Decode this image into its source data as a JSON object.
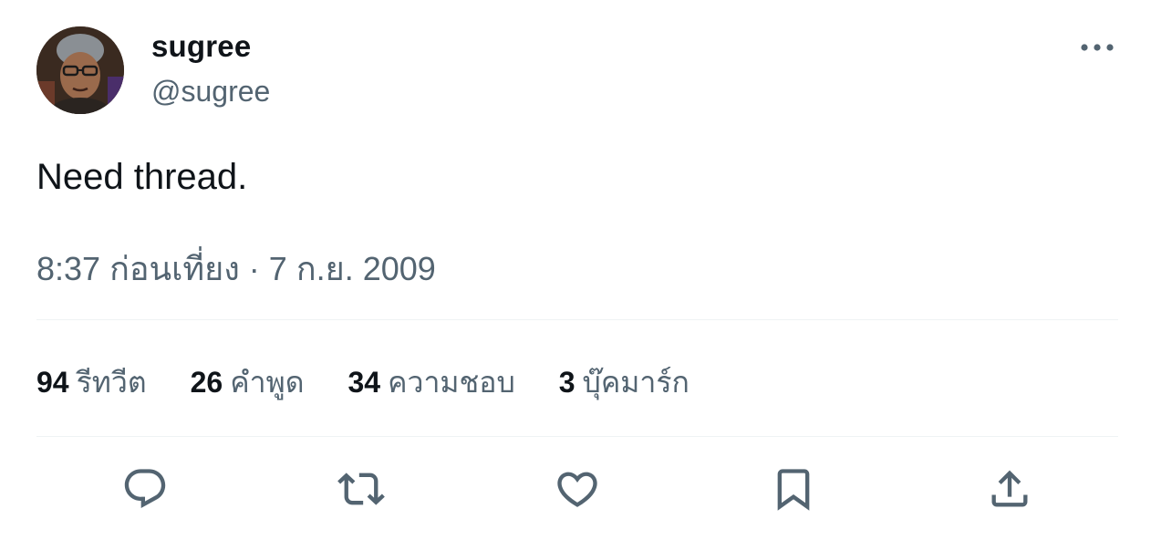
{
  "tweet": {
    "display_name": "sugree",
    "handle": "@sugree",
    "text": "Need thread.",
    "timestamp": "8:37 ก่อนเที่ยง · 7 ก.ย. 2009",
    "more_icon": "more-horizontal-icon",
    "avatar_icon": "user-avatar"
  },
  "stats": [
    {
      "count": "94",
      "label": "รีทวีต"
    },
    {
      "count": "26",
      "label": "คำพูด"
    },
    {
      "count": "34",
      "label": "ความชอบ"
    },
    {
      "count": "3",
      "label": "บุ๊คมาร์ก"
    }
  ],
  "actions": [
    {
      "name": "reply",
      "icon": "reply-bubble-icon"
    },
    {
      "name": "retweet",
      "icon": "retweet-icon"
    },
    {
      "name": "like",
      "icon": "heart-icon"
    },
    {
      "name": "bookmark",
      "icon": "bookmark-icon"
    },
    {
      "name": "share",
      "icon": "share-upload-icon"
    }
  ],
  "colors": {
    "primary_text": "#0f1419",
    "secondary_text": "#536471",
    "divider": "#eff3f4",
    "background": "#ffffff"
  }
}
